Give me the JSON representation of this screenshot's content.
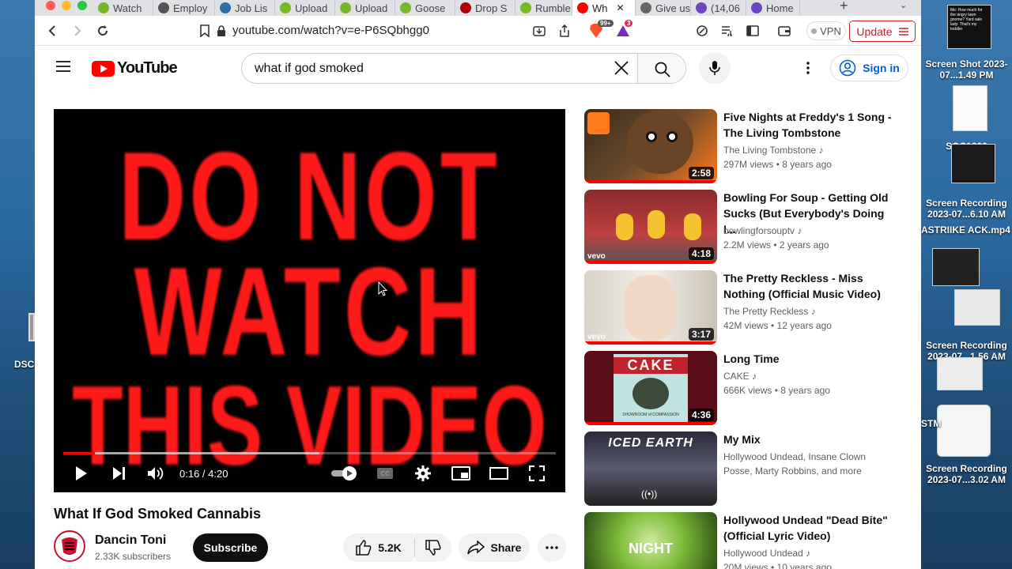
{
  "browser": {
    "tabs": [
      {
        "label": "Watch",
        "color": "#76b82a"
      },
      {
        "label": "Employ",
        "color": "#555555"
      },
      {
        "label": "Job Lis",
        "color": "#2f6ea5"
      },
      {
        "label": "Upload",
        "color": "#76b82a"
      },
      {
        "label": "Upload",
        "color": "#76b82a"
      },
      {
        "label": "Goose",
        "color": "#76b82a"
      },
      {
        "label": "Drop S",
        "color": "#b00000"
      },
      {
        "label": "Rumble",
        "color": "#76b82a"
      },
      {
        "label": "Wh",
        "color": "#ff0000"
      },
      {
        "label": "Give us",
        "color": "#666666"
      },
      {
        "label": "(14,06",
        "color": "#6b46c1"
      },
      {
        "label": "Home",
        "color": "#6b46c1"
      }
    ],
    "url": "youtube.com/watch?v=e-P6SQbhgg0",
    "brave_badge": "99+",
    "alert_badge": "3",
    "vpn_label": "VPN",
    "update_label": "Update"
  },
  "youtube": {
    "logo_text": "YouTube",
    "search_query": "what if god smoked",
    "signin_label": "Sign in"
  },
  "player": {
    "warning_lines": [
      "DO NOT",
      "WATCH",
      "THIS VIDEO"
    ],
    "current_time": "0:16",
    "duration": "4:20",
    "time_display": "0:16 / 4:20",
    "progress_fraction": 0.064
  },
  "video": {
    "title": "What If God Smoked Cannabis",
    "channel": "Dancin Toni",
    "subscribers": "2.33K subscribers",
    "subscribe_label": "Subscribe",
    "likes": "5.2K",
    "share_label": "Share"
  },
  "recommendations": [
    {
      "title": "Five Nights at Freddy's 1 Song - The Living Tombstone",
      "channel": "The Living Tombstone",
      "stats": "297M views • 8 years ago",
      "duration": "2:58"
    },
    {
      "title": "Bowling For Soup - Getting Old Sucks (But Everybody's Doing I...",
      "channel": "bowlingforsouptv",
      "stats": "2.2M views • 2 years ago",
      "duration": "4:18"
    },
    {
      "title": "The Pretty Reckless - Miss Nothing (Official Music Video)",
      "channel": "The Pretty Reckless",
      "stats": "42M views • 12 years ago",
      "duration": "3:17"
    },
    {
      "title": "Long Time",
      "channel": "CAKE",
      "stats": "666K views • 8 years ago",
      "duration": "4:36"
    },
    {
      "title": "My Mix",
      "channel": "Hollywood Undead, Insane Clown Posse, Marty Robbins, and more",
      "stats": "",
      "duration": ""
    },
    {
      "title": "Hollywood Undead \"Dead Bite\" (Official Lyric Video)",
      "channel": "Hollywood Undead",
      "stats": "20M views • 10 years ago",
      "duration": ""
    }
  ],
  "thumb_text": {
    "cake_logo": "CAKE",
    "cake_sub": "SHOWROOM of COMPASSION",
    "night": "NIGHT",
    "iced_earth": "ICED EARTH"
  },
  "desktop": {
    "left_label": "DSC",
    "items": [
      {
        "label": "Screen Shot 2023-07...1.49 PM"
      },
      {
        "label": "SOC1800"
      },
      {
        "label": "Screen Recording 2023-07...6.10 AM"
      },
      {
        "label": "ASTRIIKE ACK.mp4"
      },
      {
        "label": "Screen Recording 2023-07...1.56 AM"
      },
      {
        "label": "STM"
      },
      {
        "label": "Screen Recording 2023-07...3.02 AM"
      }
    ]
  },
  "colors": {
    "yt_red": "#ff0000",
    "link_blue": "#065fd4",
    "warning_red": "#ff1a1a"
  }
}
